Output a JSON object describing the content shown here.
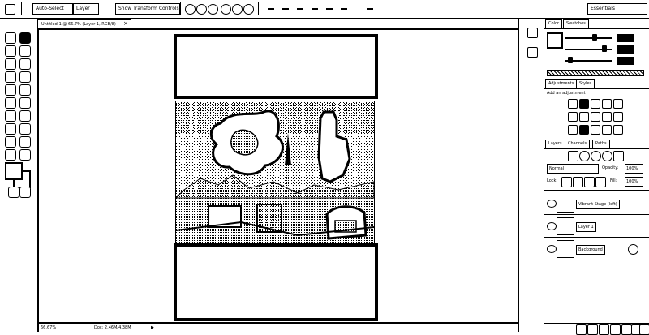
{
  "options_bar": {
    "auto_select_label": "Auto-Select",
    "layer_dropdown": "Layer",
    "transform_controls_label": "Show Transform Controls",
    "workspace_button": "Essentials"
  },
  "document": {
    "tab_title": "Untitled-1 @ 66.7% (Layer 1, RGB/8)",
    "close_glyph": "×",
    "zoom_status": "66.67%",
    "doc_size_status": "Doc: 2.46M/4.38M"
  },
  "panels": {
    "color_tabs": [
      "Color",
      "Swatches"
    ],
    "adjustments_tabs": [
      "Adjustments",
      "Styles"
    ],
    "adjustments_prompt": "Add an adjustment",
    "layers_tabs": [
      "Layers",
      "Channels",
      "Paths"
    ],
    "blend_mode": "Normal",
    "opacity_label": "Opacity:",
    "opacity_value": "100%",
    "lock_label": "Lock:",
    "fill_label": "Fill:",
    "fill_value": "100%",
    "layers": [
      {
        "name": "Vibrant Stage (left)"
      },
      {
        "name": "Layer 1"
      },
      {
        "name": "Background"
      }
    ]
  },
  "icons": {
    "move_tool": "move-icon",
    "eye": "eye-icon",
    "lock": "lock-icon",
    "color_picker": "color-swatch-icon"
  }
}
